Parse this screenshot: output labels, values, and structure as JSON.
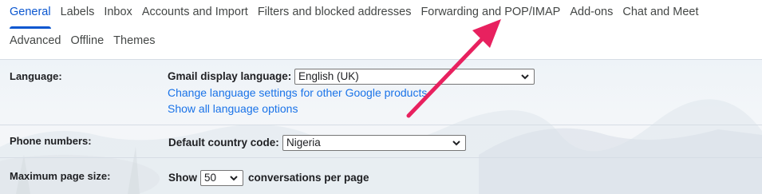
{
  "tabs": {
    "row1": [
      "General",
      "Labels",
      "Inbox",
      "Accounts and Import",
      "Filters and blocked addresses",
      "Forwarding and POP/IMAP",
      "Add-ons",
      "Chat and Meet"
    ],
    "row2": [
      "Advanced",
      "Offline",
      "Themes"
    ],
    "active": "General"
  },
  "language": {
    "label": "Language:",
    "display_label": "Gmail display language:",
    "selected": "English (UK)",
    "link1": "Change language settings for other Google products",
    "link2": "Show all language options"
  },
  "phone": {
    "label": "Phone numbers:",
    "field_label": "Default country code:",
    "selected": "Nigeria"
  },
  "page_size": {
    "label": "Maximum page size:",
    "prefix": "Show",
    "selected": "50",
    "suffix": "conversations per page"
  },
  "colors": {
    "accent": "#0b57d0",
    "link": "#1a73e8",
    "arrow": "#e8215f"
  },
  "icons": {
    "select_chevron": "chevron-down-icon",
    "annotation": "arrow-icon"
  }
}
